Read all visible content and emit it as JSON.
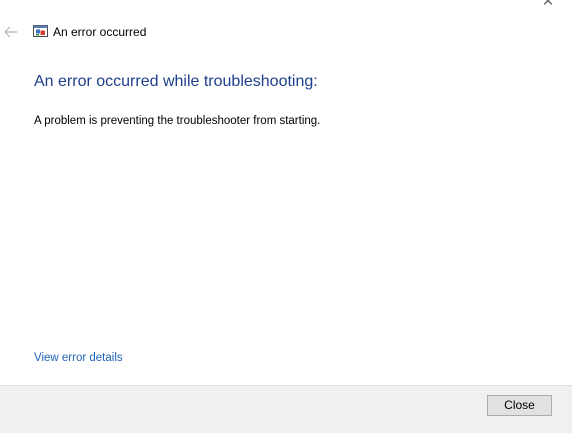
{
  "window": {
    "title": "An error occurred",
    "close_glyph": "✕"
  },
  "icons": {
    "back": "back-arrow-icon",
    "title": "troubleshooter-icon"
  },
  "main": {
    "heading": "An error occurred while troubleshooting:",
    "message": "A problem is preventing the troubleshooter from starting.",
    "details_link": "View error details"
  },
  "footer": {
    "close_label": "Close"
  },
  "colors": {
    "heading": "#1e3f8c",
    "link": "#1f63b6",
    "footer_bg": "#f0f0f0"
  }
}
